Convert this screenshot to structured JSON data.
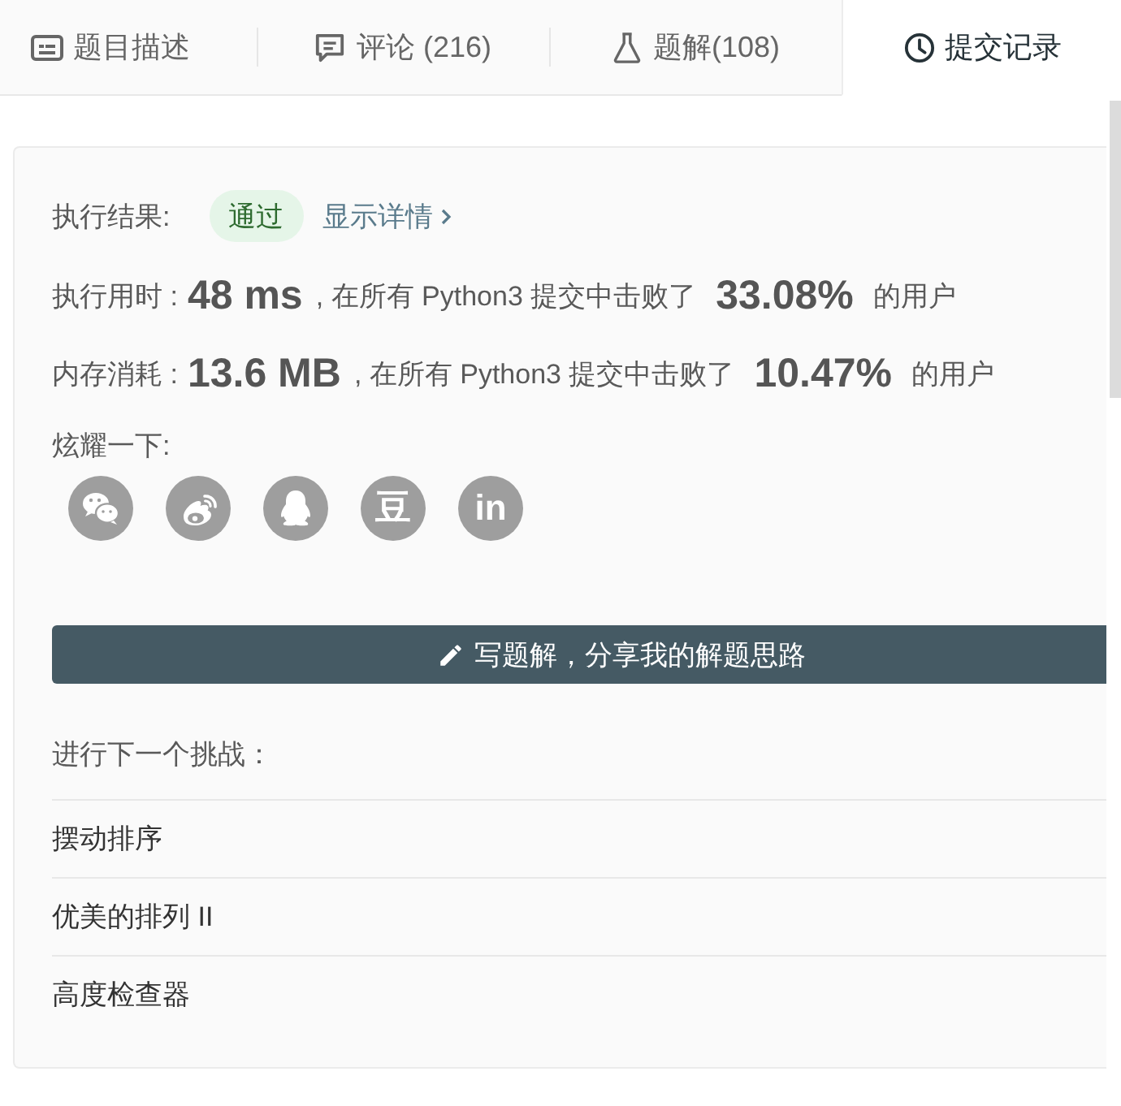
{
  "tabs": [
    {
      "label": "题目描述",
      "selected": false
    },
    {
      "label": "评论 (216)",
      "selected": false
    },
    {
      "label": "题解(108)",
      "selected": false
    },
    {
      "label": "提交记录",
      "selected": true
    }
  ],
  "result": {
    "label": "执行结果:",
    "status": "通过",
    "details_link": "显示详情"
  },
  "stats": [
    {
      "label": "执行用时 :",
      "value": "48 ms",
      "text": ", 在所有 Python3 提交中击败了",
      "percent": "33.08%",
      "suffix": "的用户"
    },
    {
      "label": "内存消耗 :",
      "value": "13.6 MB",
      "text": ", 在所有 Python3 提交中击败了",
      "percent": "10.47%",
      "suffix": "的用户"
    }
  ],
  "share": {
    "label": "炫耀一下:",
    "buttons": [
      {
        "kind": "chat"
      },
      {
        "kind": "swirl"
      },
      {
        "kind": "penguin"
      },
      {
        "kind": "text",
        "text": "豆"
      },
      {
        "kind": "text",
        "text": "in"
      }
    ]
  },
  "write_button": {
    "label": "写题解，分享我的解题思路"
  },
  "next": {
    "label": "进行下一个挑战：",
    "problems": [
      "摆动排序",
      "优美的排列 II",
      "高度检查器"
    ]
  }
}
